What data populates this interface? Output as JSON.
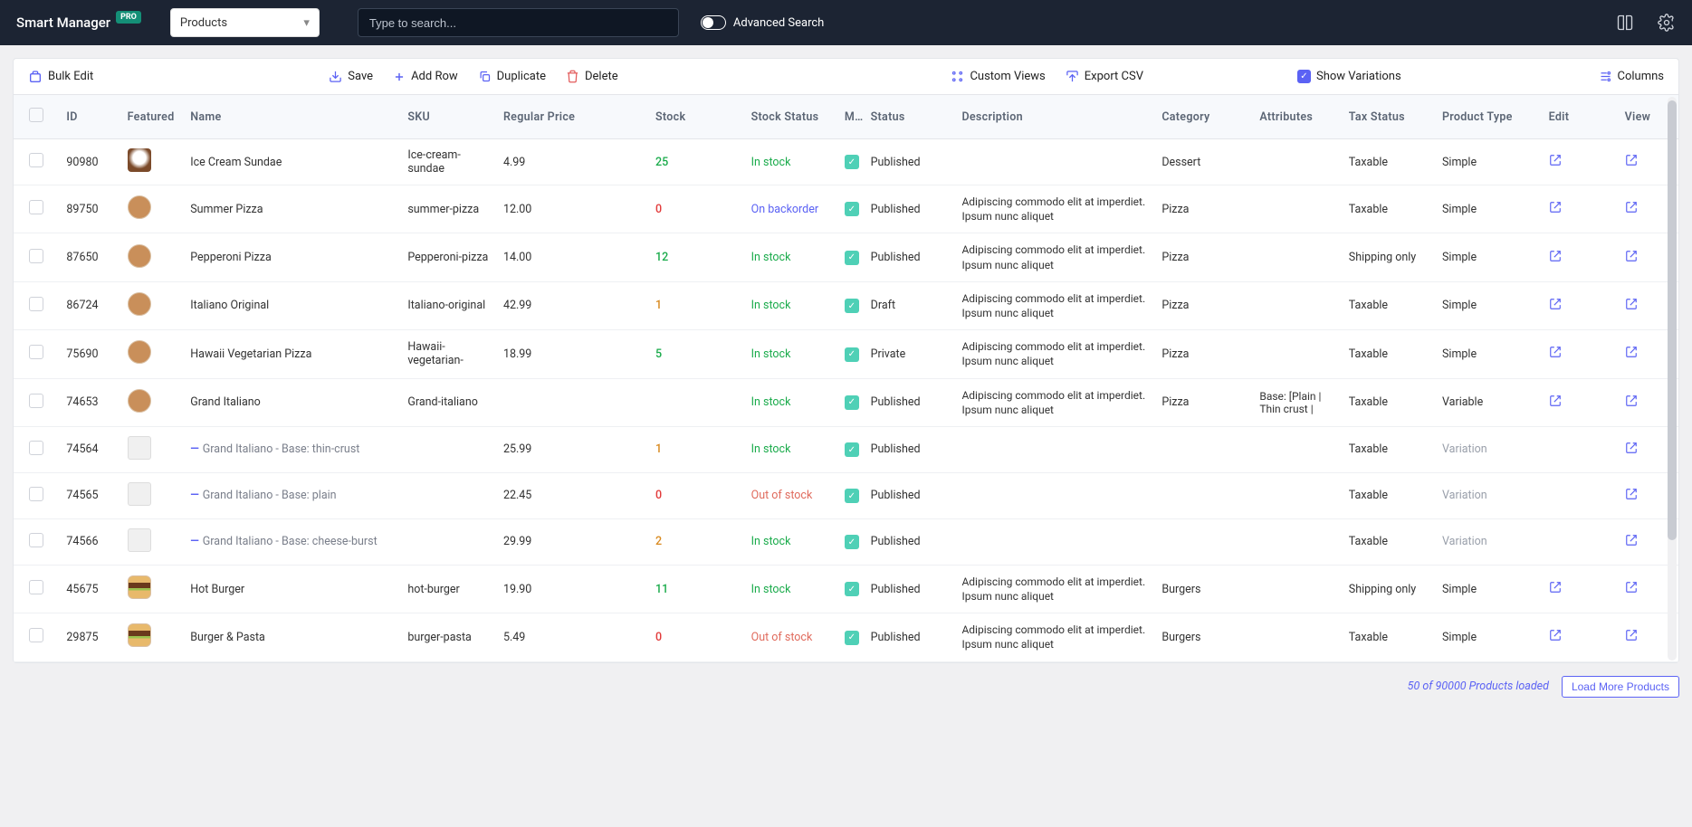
{
  "header": {
    "brand": "Smart Manager",
    "badge": "PRO",
    "selector_value": "Products",
    "search_placeholder": "Type to search...",
    "adv_search_label": "Advanced Search"
  },
  "toolbar": {
    "bulk_edit": "Bulk Edit",
    "save": "Save",
    "add_row": "Add Row",
    "duplicate": "Duplicate",
    "delete": "Delete",
    "custom_views": "Custom Views",
    "export_csv": "Export CSV",
    "show_variations": "Show Variations",
    "columns": "Columns"
  },
  "columns": [
    "",
    "ID",
    "Featured",
    "Name",
    "SKU",
    "Regular Price",
    "Stock",
    "Stock Status",
    "Ma",
    "Status",
    "Description",
    "Category",
    "Attributes",
    "Tax Status",
    "Product Type",
    "Edit",
    "View"
  ],
  "col_widths": [
    "42px",
    "56px",
    "58px",
    "200px",
    "88px",
    "140px",
    "88px",
    "86px",
    "24px",
    "84px",
    "184px",
    "90px",
    "82px",
    "86px",
    "98px",
    "70px",
    "56px"
  ],
  "desc_text": "Adipiscing commodo elit at imperdiet. Ipsum nunc aliquet",
  "rows": [
    {
      "id": "90980",
      "thumb": "sundae",
      "name": "Ice Cream Sundae",
      "variation": false,
      "sku": "Ice-cream-sundae",
      "price": "4.99",
      "stock": "25",
      "stock_cls": "green",
      "stock_status": "In stock",
      "ss_cls": "instock",
      "state": "Published",
      "desc": false,
      "category": "Dessert",
      "attributes": "",
      "tax": "Taxable",
      "ptype": "Simple",
      "edit": true,
      "view": true
    },
    {
      "id": "89750",
      "thumb": "pizza",
      "name": "Summer Pizza",
      "variation": false,
      "sku": "summer-pizza",
      "price": "12.00",
      "stock": "0",
      "stock_cls": "red",
      "stock_status": "On backorder",
      "ss_cls": "backorder",
      "state": "Published",
      "desc": true,
      "category": "Pizza",
      "attributes": "",
      "tax": "Taxable",
      "ptype": "Simple",
      "edit": true,
      "view": true
    },
    {
      "id": "87650",
      "thumb": "pizza",
      "name": "Pepperoni Pizza",
      "variation": false,
      "sku": "Pepperoni-pizza",
      "price": "14.00",
      "stock": "12",
      "stock_cls": "green",
      "stock_status": "In stock",
      "ss_cls": "instock",
      "state": "Published",
      "desc": true,
      "category": "Pizza",
      "attributes": "",
      "tax": "Shipping only",
      "ptype": "Simple",
      "edit": true,
      "view": true
    },
    {
      "id": "86724",
      "thumb": "pizza",
      "name": "Italiano Original",
      "variation": false,
      "sku": "Italiano-original",
      "price": "42.99",
      "stock": "1",
      "stock_cls": "orange",
      "stock_status": "In stock",
      "ss_cls": "instock",
      "state": "Draft",
      "desc": true,
      "category": "Pizza",
      "attributes": "",
      "tax": "Taxable",
      "ptype": "Simple",
      "edit": true,
      "view": true
    },
    {
      "id": "75690",
      "thumb": "pizza",
      "name": "Hawaii Vegetarian Pizza",
      "variation": false,
      "sku": "Hawaii-vegetarian-",
      "price": "18.99",
      "stock": "5",
      "stock_cls": "green",
      "stock_status": "In stock",
      "ss_cls": "instock",
      "state": "Private",
      "desc": true,
      "category": "Pizza",
      "attributes": "",
      "tax": "Taxable",
      "ptype": "Simple",
      "edit": true,
      "view": true
    },
    {
      "id": "74653",
      "thumb": "pizza",
      "name": "Grand Italiano",
      "variation": false,
      "sku": "Grand-italiano",
      "price": "",
      "stock": "",
      "stock_cls": "",
      "stock_status": "In stock",
      "ss_cls": "instock",
      "state": "Published",
      "desc": true,
      "category": "Pizza",
      "attributes": "Base: [Plain | Thin crust |",
      "tax": "Taxable",
      "ptype": "Variable",
      "edit": true,
      "view": true
    },
    {
      "id": "74564",
      "thumb": "placeholder",
      "name": "Grand Italiano - Base: thin-crust",
      "variation": true,
      "sku": "",
      "price": "25.99",
      "stock": "1",
      "stock_cls": "orange",
      "stock_status": "In stock",
      "ss_cls": "instock",
      "state": "Published",
      "desc": false,
      "category": "",
      "attributes": "",
      "tax": "Taxable",
      "ptype": "Variation",
      "edit": false,
      "view": true
    },
    {
      "id": "74565",
      "thumb": "placeholder",
      "name": "Grand Italiano - Base: plain",
      "variation": true,
      "sku": "",
      "price": "22.45",
      "stock": "0",
      "stock_cls": "red",
      "stock_status": "Out of stock",
      "ss_cls": "out",
      "state": "Published",
      "desc": false,
      "category": "",
      "attributes": "",
      "tax": "Taxable",
      "ptype": "Variation",
      "edit": false,
      "view": true
    },
    {
      "id": "74566",
      "thumb": "placeholder",
      "name": "Grand Italiano - Base: cheese-burst",
      "variation": true,
      "sku": "",
      "price": "29.99",
      "stock": "2",
      "stock_cls": "orange",
      "stock_status": "In stock",
      "ss_cls": "instock",
      "state": "Published",
      "desc": false,
      "category": "",
      "attributes": "",
      "tax": "Taxable",
      "ptype": "Variation",
      "edit": false,
      "view": true
    },
    {
      "id": "45675",
      "thumb": "burger",
      "name": "Hot Burger",
      "variation": false,
      "sku": "hot-burger",
      "price": "19.90",
      "stock": "11",
      "stock_cls": "green",
      "stock_status": "In stock",
      "ss_cls": "instock",
      "state": "Published",
      "desc": true,
      "category": "Burgers",
      "attributes": "",
      "tax": "Shipping only",
      "ptype": "Simple",
      "edit": true,
      "view": true
    },
    {
      "id": "29875",
      "thumb": "burger",
      "name": "Burger & Pasta",
      "variation": false,
      "sku": "burger-pasta",
      "price": "5.49",
      "stock": "0",
      "stock_cls": "red",
      "stock_status": "Out of stock",
      "ss_cls": "out",
      "state": "Published",
      "desc": true,
      "category": "Burgers",
      "attributes": "",
      "tax": "Taxable",
      "ptype": "Simple",
      "edit": true,
      "view": true
    }
  ],
  "footer": {
    "loaded_text": "50 of 90000 Products loaded",
    "load_more": "Load More Products"
  }
}
